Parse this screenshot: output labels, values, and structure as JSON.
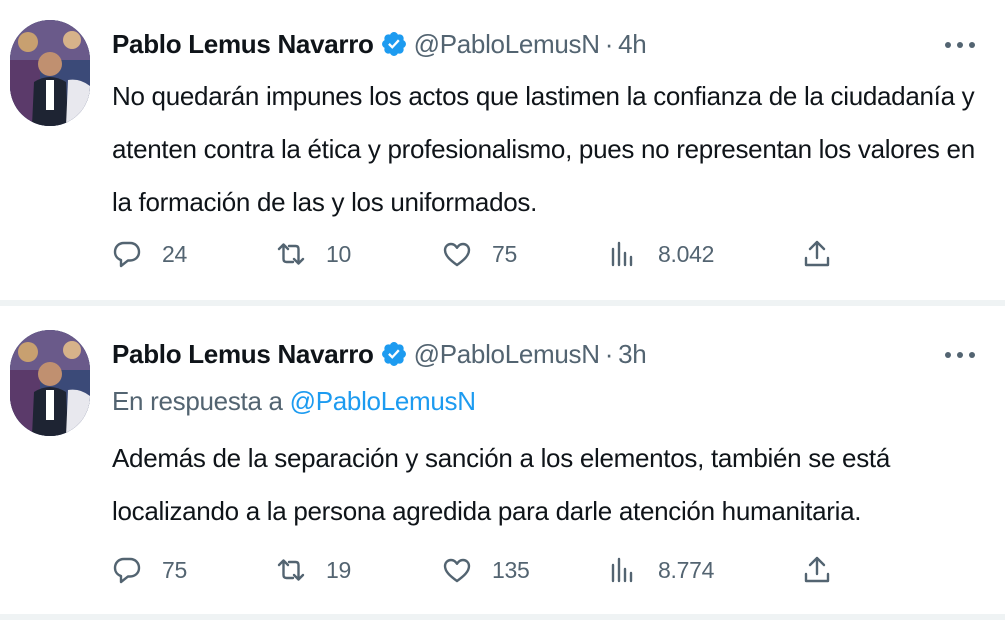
{
  "tweets": [
    {
      "author_name": "Pablo Lemus Navarro",
      "handle": "@PabloLemusN",
      "separator": "·",
      "time": "4h",
      "reply_prefix": "",
      "reply_handle": "",
      "text": "No quedarán impunes los actos que lastimen la confianza de la ciudadanía y atenten contra la ética y profesionalismo, pues no representan los valores en la formación de las y los uniformados.",
      "replies": "24",
      "retweets": "10",
      "likes": "75",
      "views": "8.042"
    },
    {
      "author_name": "Pablo Lemus Navarro",
      "handle": "@PabloLemusN",
      "separator": "·",
      "time": "3h",
      "reply_prefix": "En respuesta a ",
      "reply_handle": "@PabloLemusN",
      "text": "Además de la separación y sanción a los elementos, también se está localizando a la persona agredida para darle atención humanitaria.",
      "replies": "75",
      "retweets": "19",
      "likes": "135",
      "views": "8.774"
    }
  ],
  "colors": {
    "accent": "#1d9bf0",
    "text_primary": "#0f1419",
    "text_secondary": "#536471",
    "divider": "#eff3f4"
  },
  "icons": [
    "verified-badge-icon",
    "more-icon",
    "reply-icon",
    "retweet-icon",
    "like-icon",
    "views-icon",
    "share-icon"
  ]
}
